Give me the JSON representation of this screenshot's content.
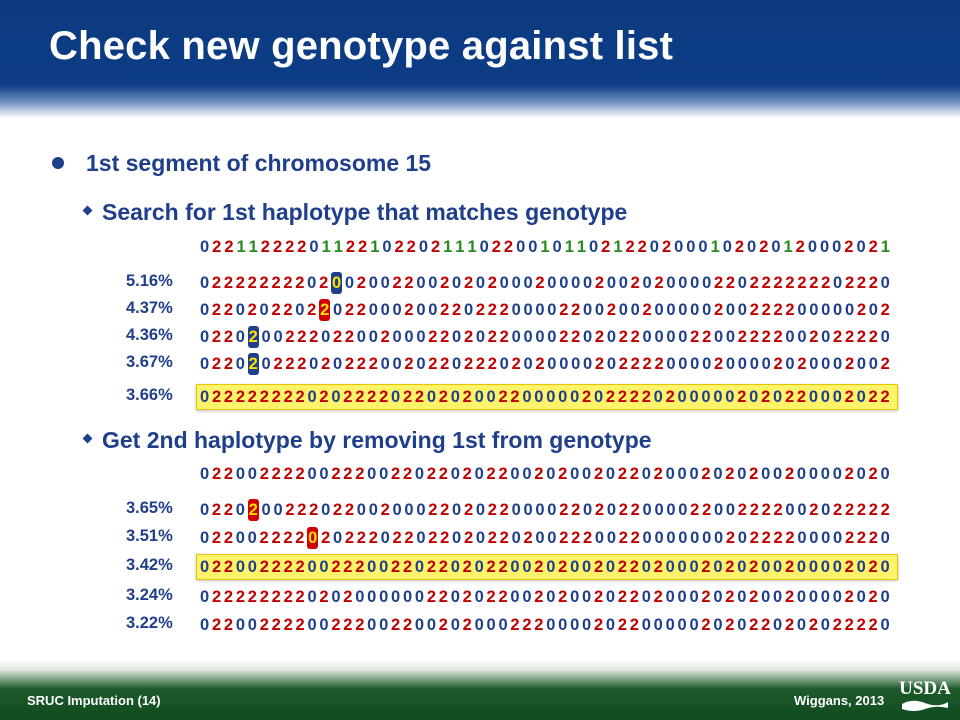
{
  "title": "Check new genotype against list",
  "bullets": {
    "main": "1st segment of chromosome 15",
    "sub1": "Search for 1st haplotype that matches genotype",
    "sub2": "Get 2nd haplotype by removing 1st from genotype"
  },
  "genotype": "0221122220112210220211102200101102122020001020201200020 21",
  "list1": [
    {
      "pct": "5.16%",
      "seq": "0222222220200200220020202000200002002020000220222222202220"
    },
    {
      "pct": "4.37%",
      "seq": "0220202202202200020022022200002200200200000200222200000202"
    },
    {
      "pct": "4.36%",
      "seq": "0220200222022002000220202200002202022000022002222002022220"
    },
    {
      "pct": "3.67%",
      "seq": "0220202220202220020220222020200002022220000200002020002002"
    },
    {
      "pct": "3.66%",
      "seq": "0222222220202222022020200220000020222202000002020220002022"
    }
  ],
  "genotype2": "0220022220022200220220202200202002022020002020200200002020",
  "list2": [
    {
      "pct": "3.65%",
      "seq": "0220200222022002000220202200002202022000022002222002022222"
    },
    {
      "pct": "3.51%",
      "seq": "0220022220202220220220202202002220022000000020222200002220"
    },
    {
      "pct": "3.42%",
      "seq": "0220022220022200220220202200202002022020002020200200002020"
    },
    {
      "pct": "3.24%",
      "seq": "0222222220202000000220202200202002022020002020200200002020"
    },
    {
      "pct": "3.22%",
      "seq": "0220022220022200220020200022200002022000002020220202022220"
    }
  ],
  "footer": {
    "left": "SRUC Imputation  (14)",
    "right": "Wiggans, 2013",
    "logo_text": "USDA"
  },
  "colors": {
    "digit0": "#1f3f8a",
    "digit1": "#2a8a22",
    "digit2": "#c00000",
    "highlight": "#fff36a",
    "header": "#0d3d86",
    "footer": "#0f4a20"
  }
}
